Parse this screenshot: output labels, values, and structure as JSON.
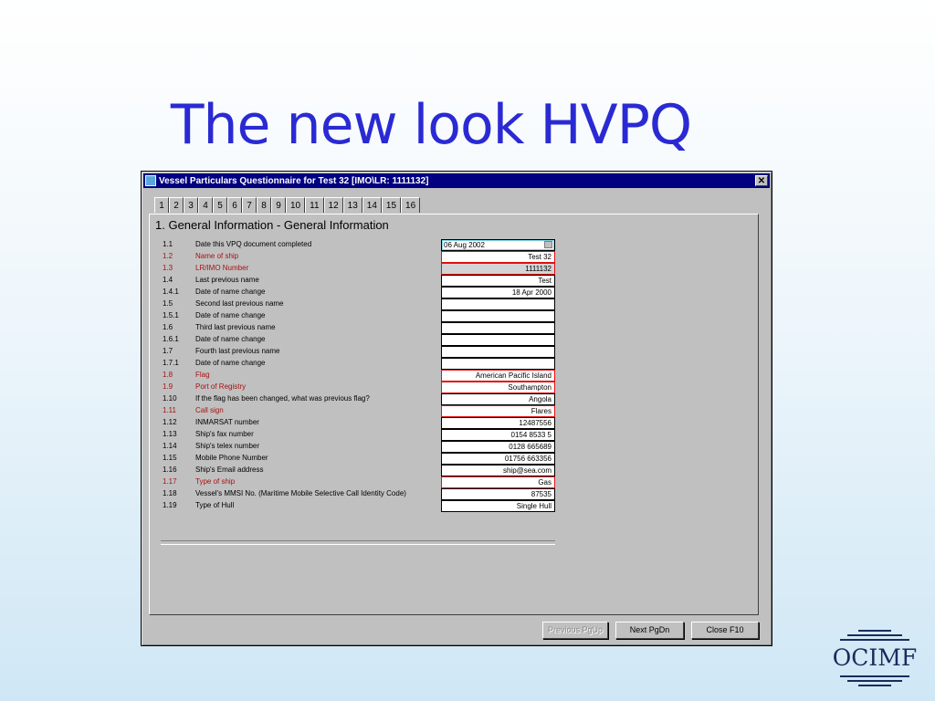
{
  "slide": {
    "title": "The new look HVPQ"
  },
  "window": {
    "title": "Vessel Particulars Questionnaire for Test 32 [IMO\\LR: 1111132]",
    "close_label": "✕",
    "tabs": [
      "1",
      "2",
      "3",
      "4",
      "5",
      "6",
      "7",
      "8",
      "9",
      "10",
      "11",
      "12",
      "13",
      "14",
      "15",
      "16"
    ],
    "active_tab": "1",
    "section_heading": "1. General Information - General Information",
    "rows": [
      {
        "num": "1.1",
        "label": "Date this VPQ document completed",
        "value": "06 Aug 2002",
        "required": false
      },
      {
        "num": "1.2",
        "label": "Name of ship",
        "value": "Test 32",
        "required": true
      },
      {
        "num": "1.3",
        "label": "LR/IMO Number",
        "value": "1111132",
        "required": true
      },
      {
        "num": "1.4",
        "label": "Last previous name",
        "value": "Test",
        "required": false
      },
      {
        "num": "1.4.1",
        "label": "Date of name change",
        "value": "18 Apr 2000",
        "required": false
      },
      {
        "num": "1.5",
        "label": "Second last previous name",
        "value": "",
        "required": false
      },
      {
        "num": "1.5.1",
        "label": "Date of name change",
        "value": "",
        "required": false
      },
      {
        "num": "1.6",
        "label": "Third last previous name",
        "value": "",
        "required": false
      },
      {
        "num": "1.6.1",
        "label": "Date of name change",
        "value": "",
        "required": false
      },
      {
        "num": "1.7",
        "label": "Fourth last previous name",
        "value": "",
        "required": false
      },
      {
        "num": "1.7.1",
        "label": "Date of name change",
        "value": "",
        "required": false
      },
      {
        "num": "1.8",
        "label": "Flag",
        "value": "American Pacific Island",
        "required": true
      },
      {
        "num": "1.9",
        "label": "Port of Registry",
        "value": "Southampton",
        "required": true
      },
      {
        "num": "1.10",
        "label": "If the flag has been changed, what was previous flag?",
        "value": "Angola",
        "required": false
      },
      {
        "num": "1.11",
        "label": "Call sign",
        "value": "Flares",
        "required": true
      },
      {
        "num": "1.12",
        "label": "INMARSAT number",
        "value": "12487556",
        "required": false
      },
      {
        "num": "1.13",
        "label": "Ship's fax number",
        "value": "0154 8533 5",
        "required": false
      },
      {
        "num": "1.14",
        "label": "Ship's telex number",
        "value": "0128 665689",
        "required": false
      },
      {
        "num": "1.15",
        "label": "Mobile Phone Number",
        "value": "01756 663356",
        "required": false
      },
      {
        "num": "1.16",
        "label": "Ship's Email address",
        "value": "ship@sea.com",
        "required": false
      },
      {
        "num": "1.17",
        "label": "Type of ship",
        "value": "Gas",
        "required": true
      },
      {
        "num": "1.18",
        "label": "Vessel's MMSI No. (Maritime Mobile Selective Call Identity Code)",
        "value": "87535",
        "required": false
      },
      {
        "num": "1.19",
        "label": "Type of Hull",
        "value": "Single Hull",
        "required": false
      }
    ],
    "buttons": {
      "previous": "Previous PgUp",
      "next": "Next PgDn",
      "close": "Close F10"
    }
  },
  "logo": {
    "text": "OCIMF",
    "color": "#1a2b5c"
  },
  "colors": {
    "title": "#2a2ad4",
    "titlebar": "#000080",
    "required": "#aa1010",
    "required_border": "#e01010"
  }
}
